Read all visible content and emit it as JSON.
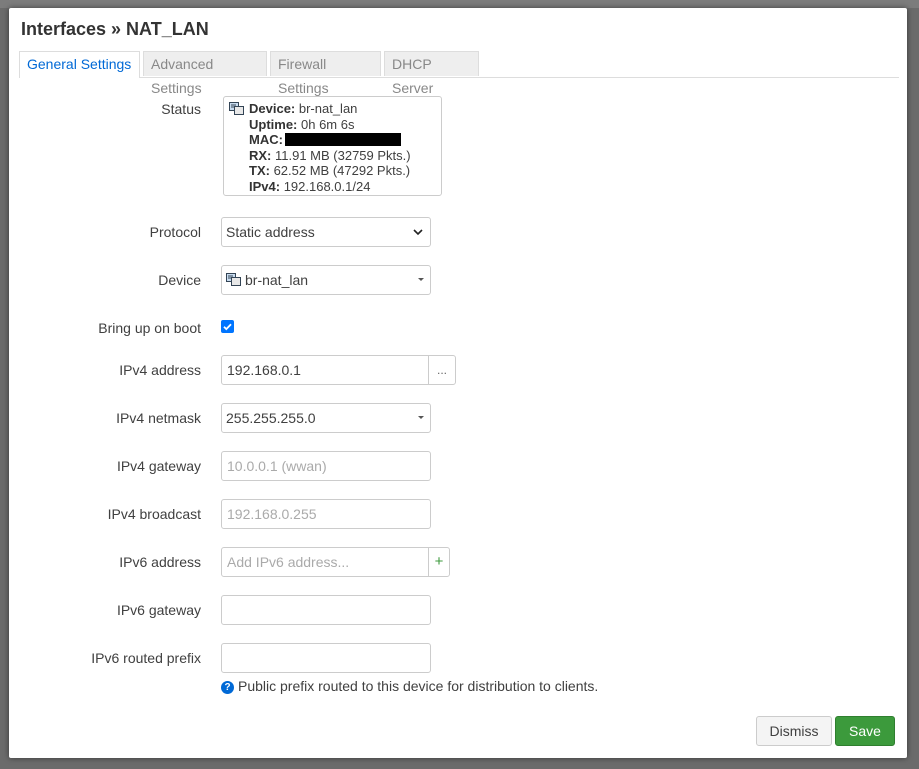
{
  "modal": {
    "title": "Interfaces » NAT_LAN",
    "tabs": [
      "General Settings",
      "Advanced Settings",
      "Firewall Settings",
      "DHCP Server"
    ]
  },
  "status": {
    "label": "Status",
    "device_key": "Device:",
    "device_val": " br-nat_lan",
    "uptime_key": "Uptime:",
    "uptime_val": " 0h 6m 6s",
    "mac_key": "MAC:",
    "rx_key": "RX:",
    "rx_val": " 11.91 MB (32759 Pkts.)",
    "tx_key": "TX:",
    "tx_val": " 62.52 MB (47292 Pkts.)",
    "ipv4_key": "IPv4:",
    "ipv4_val": " 192.168.0.1/24"
  },
  "fields": {
    "protocol": {
      "label": "Protocol",
      "value": "Static address"
    },
    "device": {
      "label": "Device",
      "value": "br-nat_lan"
    },
    "boot": {
      "label": "Bring up on boot",
      "checked": true
    },
    "ipv4_address": {
      "label": "IPv4 address",
      "value": "192.168.0.1",
      "addon": "..."
    },
    "ipv4_netmask": {
      "label": "IPv4 netmask",
      "value": "255.255.255.0"
    },
    "ipv4_gateway": {
      "label": "IPv4 gateway",
      "placeholder": "10.0.0.1 (wwan)"
    },
    "ipv4_broadcast": {
      "label": "IPv4 broadcast",
      "placeholder": "192.168.0.255"
    },
    "ipv6_address": {
      "label": "IPv6 address",
      "placeholder": "Add IPv6 address...",
      "addon": "+"
    },
    "ipv6_gateway": {
      "label": "IPv6 gateway",
      "value": ""
    },
    "ipv6_prefix": {
      "label": "IPv6 routed prefix",
      "value": "",
      "help": "Public prefix routed to this device for distribution to clients."
    }
  },
  "buttons": {
    "dismiss": "Dismiss",
    "save": "Save"
  },
  "colors": {
    "accent": "#0069d6",
    "save": "#3c9a3c",
    "checkbox": "#0075ff"
  }
}
